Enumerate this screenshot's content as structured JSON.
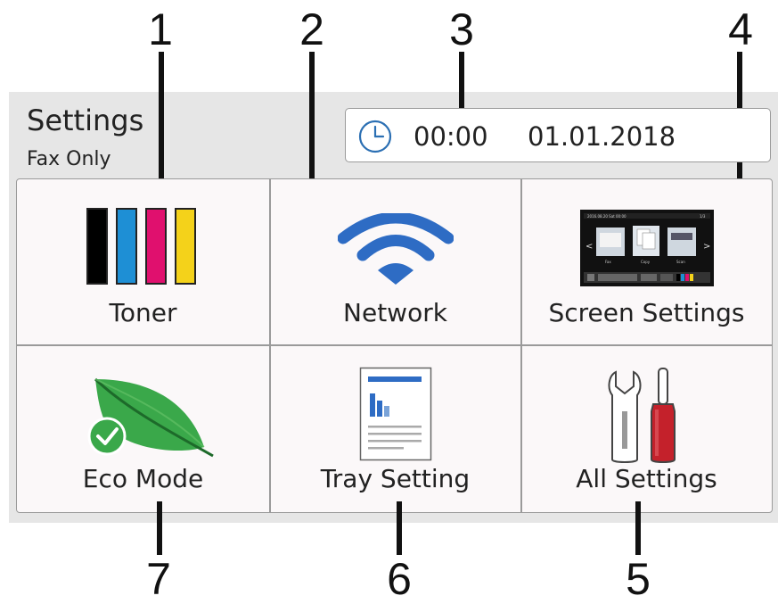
{
  "callouts": [
    "1",
    "2",
    "3",
    "4",
    "5",
    "6",
    "7"
  ],
  "header": {
    "title": "Settings",
    "subtitle": "Fax Only",
    "time": "00:00",
    "date": "01.01.2018",
    "clock_icon": "clock-icon"
  },
  "tiles": {
    "toner": {
      "label": "Toner",
      "icon": "toner-icon",
      "colors": [
        "#000000",
        "#1e8fd5",
        "#e0106e",
        "#f4d21a"
      ]
    },
    "network": {
      "label": "Network",
      "icon": "wifi-icon",
      "color": "#2e6cc4"
    },
    "screen_settings": {
      "label": "Screen Settings",
      "icon": "screen-preview-icon"
    },
    "eco_mode": {
      "label": "Eco Mode",
      "icon": "leaf-icon"
    },
    "tray_setting": {
      "label": "Tray Setting",
      "icon": "tray-document-icon"
    },
    "all_settings": {
      "label": "All Settings",
      "icon": "tools-icon"
    }
  }
}
